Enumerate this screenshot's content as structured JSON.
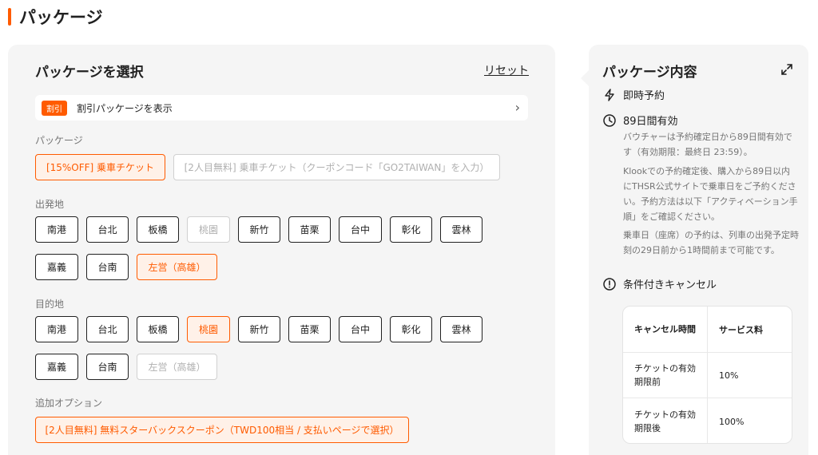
{
  "page": {
    "title": "パッケージ"
  },
  "selector": {
    "title": "パッケージを選択",
    "reset": "リセット",
    "discount": {
      "tag": "割引",
      "label": "割引パッケージを表示"
    },
    "package_label": "パッケージ",
    "packages": [
      "[15%OFF] 乗車チケット",
      "[2人目無料] 乗車チケット（クーポンコード「GO2TAIWAN」を入力）"
    ],
    "departure_label": "出発地",
    "departure": [
      "南港",
      "台北",
      "板橋",
      "桃園",
      "新竹",
      "苗栗",
      "台中",
      "彰化",
      "雲林",
      "嘉義",
      "台南",
      "左営（高雄）"
    ],
    "destination_label": "目的地",
    "destination": [
      "南港",
      "台北",
      "板橋",
      "桃園",
      "新竹",
      "苗栗",
      "台中",
      "彰化",
      "雲林",
      "嘉義",
      "台南",
      "左営（高雄）"
    ],
    "options_label": "追加オプション",
    "options": [
      "[2人目無料] 無料スターバックスクーポン（TWD100相当 / 支払いページで選択）"
    ]
  },
  "details": {
    "title": "パッケージ内容",
    "instant": "即時予約",
    "validity": "89日間有効",
    "validity_note": "バウチャーは予約確定日から89日間有効です（有効期限：最終日 23:59）。",
    "booking_note": "Klookでの予約確定後、購入から89日以内にTHSR公式サイトで乗車日をご予約ください。予約方法は以下「アクティベーション手順」をご確認ください。",
    "seat_note": "乗車日（座席）の予約は、列車の出発予定時刻の29日前から1時間前まで可能です。",
    "cancel_title": "条件付きキャンセル",
    "table": {
      "head": [
        "キャンセル時間",
        "サービス料"
      ],
      "rows": [
        [
          "チケットの有効期限前",
          "10%"
        ],
        [
          "チケットの有効期限後",
          "100%"
        ]
      ]
    }
  },
  "colors": {
    "accent": "#ff5b00",
    "selected_bg": "#fff1e8",
    "card_bg": "#f5f5f5"
  },
  "icons": [
    "bolt-icon",
    "clock-icon",
    "alert-circle-icon",
    "expand-icon",
    "chevron-right-icon"
  ]
}
